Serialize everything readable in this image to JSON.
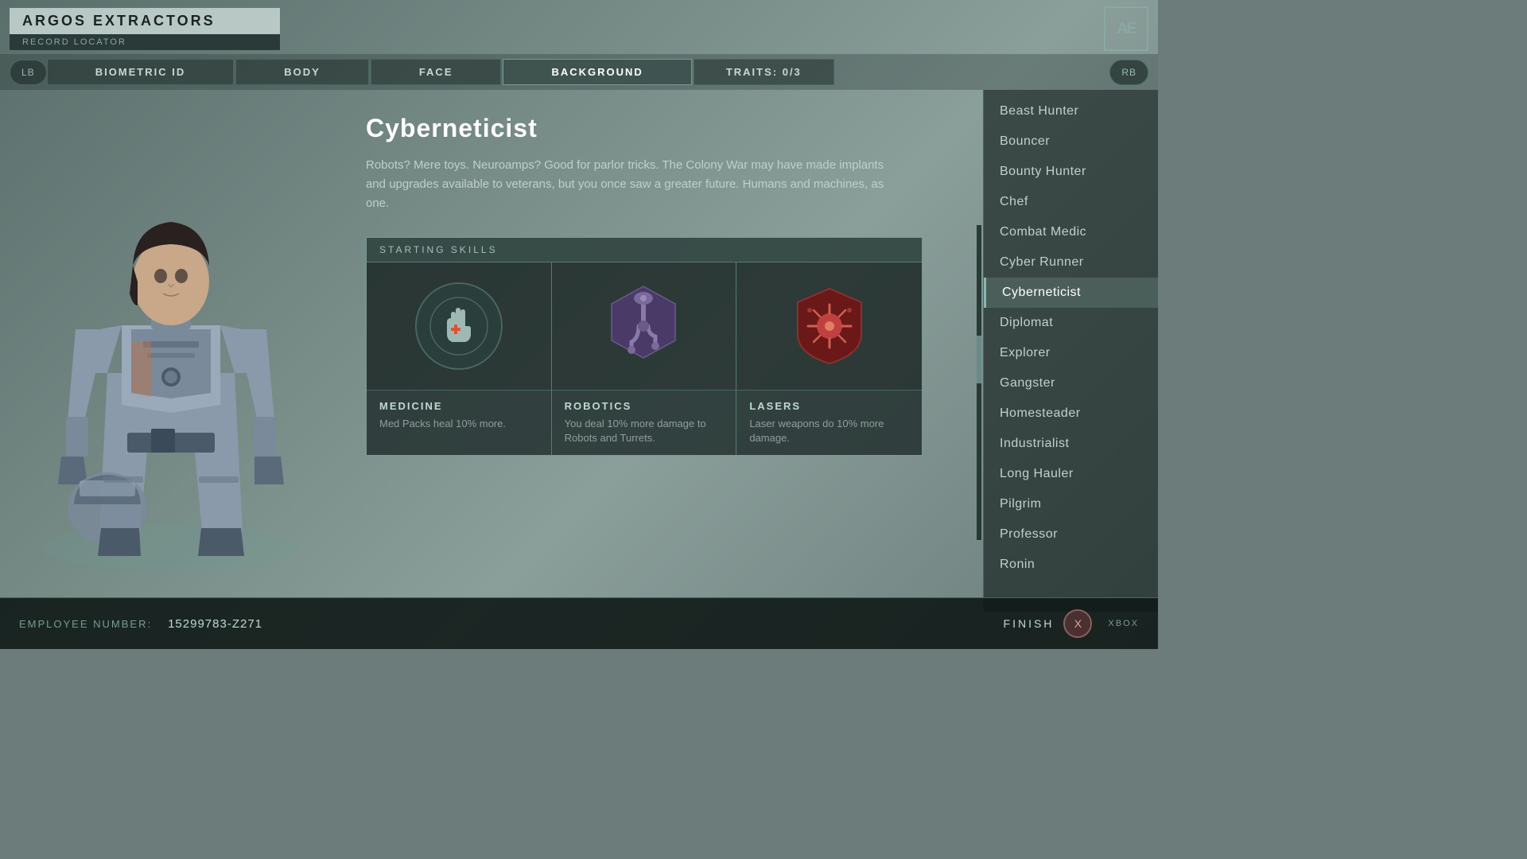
{
  "header": {
    "app_title": "ARGOS EXTRACTORS",
    "subtitle": "RECORD LOCATOR",
    "logo_text": "AE"
  },
  "nav": {
    "left_btn": "LB",
    "right_btn": "RB",
    "tabs": [
      {
        "label": "BIOMETRIC ID",
        "active": false
      },
      {
        "label": "BODY",
        "active": false
      },
      {
        "label": "FACE",
        "active": false
      },
      {
        "label": "BACKGROUND",
        "active": true
      },
      {
        "label": "TRAITS: 0/3",
        "active": false
      }
    ]
  },
  "selected_background": {
    "name": "Cyberneticist",
    "description": "Robots? Mere toys. Neuroamps? Good for parlor tricks. The Colony War may have made implants and upgrades available to veterans, but you once saw a greater future. Humans and machines, as one.",
    "skills_header": "STARTING SKILLS",
    "skills": [
      {
        "name": "MEDICINE",
        "description": "Med Packs heal 10% more.",
        "icon_type": "circle-hand"
      },
      {
        "name": "ROBOTICS",
        "description": "You deal 10% more damage to Robots and Turrets.",
        "icon_type": "hex-arm"
      },
      {
        "name": "LASERS",
        "description": "Laser weapons do 10% more damage.",
        "icon_type": "shield-star"
      }
    ]
  },
  "sidebar": {
    "items": [
      {
        "label": "Beast Hunter",
        "active": false
      },
      {
        "label": "Bouncer",
        "active": false
      },
      {
        "label": "Bounty Hunter",
        "active": false
      },
      {
        "label": "Chef",
        "active": false
      },
      {
        "label": "Combat Medic",
        "active": false
      },
      {
        "label": "Cyber Runner",
        "active": false
      },
      {
        "label": "Cyberneticist",
        "active": true
      },
      {
        "label": "Diplomat",
        "active": false
      },
      {
        "label": "Explorer",
        "active": false
      },
      {
        "label": "Gangster",
        "active": false
      },
      {
        "label": "Homesteader",
        "active": false
      },
      {
        "label": "Industrialist",
        "active": false
      },
      {
        "label": "Long Hauler",
        "active": false
      },
      {
        "label": "Pilgrim",
        "active": false
      },
      {
        "label": "Professor",
        "active": false
      },
      {
        "label": "Ronin",
        "active": false
      }
    ]
  },
  "footer": {
    "employee_label": "EMPLOYEE NUMBER:",
    "employee_number": "15299783-Z271",
    "finish_label": "FINISH",
    "finish_key": "X",
    "platform_label": "XBOX"
  }
}
